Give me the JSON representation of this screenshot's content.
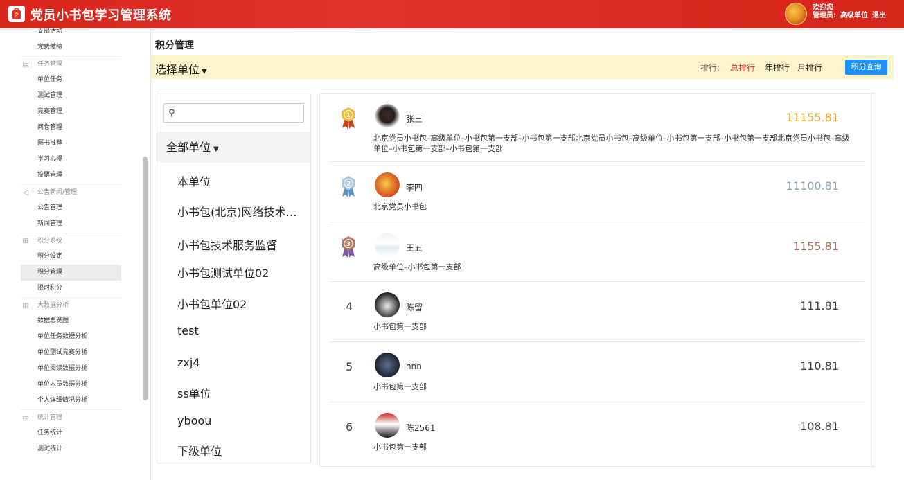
{
  "header": {
    "title": "党员小书包学习管理系统",
    "welcome": "欢迎您",
    "role_label": "管理员:",
    "unit_name": "高级单位",
    "logout": "退出"
  },
  "sidebar": {
    "items": [
      {
        "type": "item",
        "label": "支部活动"
      },
      {
        "type": "item",
        "label": "党费缴纳"
      },
      {
        "type": "group",
        "label": "任务管理",
        "icon": "list-icon"
      },
      {
        "type": "item",
        "label": "单位任务"
      },
      {
        "type": "item",
        "label": "测试管理"
      },
      {
        "type": "item",
        "label": "竞赛管理"
      },
      {
        "type": "item",
        "label": "问卷管理"
      },
      {
        "type": "item",
        "label": "图书推荐"
      },
      {
        "type": "item",
        "label": "学习心得"
      },
      {
        "type": "item",
        "label": "投票管理"
      },
      {
        "type": "group",
        "label": "公告新闻/管理",
        "icon": "speaker-icon"
      },
      {
        "type": "item",
        "label": "公告管理"
      },
      {
        "type": "item",
        "label": "新闻管理"
      },
      {
        "type": "group",
        "label": "积分系统",
        "icon": "gift-icon"
      },
      {
        "type": "item",
        "label": "积分设定"
      },
      {
        "type": "item",
        "label": "积分管理",
        "active": true
      },
      {
        "type": "item",
        "label": "限时积分"
      },
      {
        "type": "group",
        "label": "大数据分析",
        "icon": "bar-chart-icon"
      },
      {
        "type": "item",
        "label": "数据总览图"
      },
      {
        "type": "item",
        "label": "单位任务数据分析"
      },
      {
        "type": "item",
        "label": "单位测试竞赛分析"
      },
      {
        "type": "item",
        "label": "单位阅读数据分析"
      },
      {
        "type": "item",
        "label": "单位人员数据分析"
      },
      {
        "type": "item",
        "label": "个人详细情况分析"
      },
      {
        "type": "group",
        "label": "统计管理",
        "icon": "monitor-icon"
      },
      {
        "type": "item",
        "label": "任务统计"
      },
      {
        "type": "item",
        "label": "测试统计"
      }
    ]
  },
  "page": {
    "title": "积分管理",
    "unit_select": "选择单位",
    "rank_label": "排行:",
    "rank_options": [
      "总排行",
      "年排行",
      "月排行"
    ],
    "query_button": "积分查询"
  },
  "unit_panel": {
    "search_placeholder": "",
    "all_units": "全部单位",
    "units": [
      "本单位",
      "小书包(北京)网络技术有限公司",
      "小书包技术服务监督",
      "小书包测试单位02",
      "小书包单位02",
      "test",
      "zxj4",
      "ss单位",
      "yboou",
      "下级单位"
    ]
  },
  "ranking": [
    {
      "rank": "1",
      "name": "张三",
      "score": "11155.81",
      "score_color": "#e8a92a",
      "medal": "gold",
      "path": "北京党员小书包–高级单位–小书包第一支部–小书包第一支部北京党员小书包–高级单位–小书包第一支部–小书包第一支部北京党员小书包–高级单位–小书包第一支部–小书包第一支部"
    },
    {
      "rank": "2",
      "name": "李四",
      "score": "11100.81",
      "score_color": "#8ba5bd",
      "medal": "silver",
      "path": "北京党员小书包"
    },
    {
      "rank": "3",
      "name": "王五",
      "score": "1155.81",
      "score_color": "#a56a55",
      "medal": "bronze",
      "path": "高级单位–小书包第一支部"
    },
    {
      "rank": "4",
      "name": "陈留",
      "score": "111.81",
      "score_color": "#444444",
      "path": "小书包第一支部"
    },
    {
      "rank": "5",
      "name": "nnn",
      "score": "110.81",
      "score_color": "#444444",
      "path": "小书包第一支部"
    },
    {
      "rank": "6",
      "name": "陈2561",
      "score": "108.81",
      "score_color": "#444444",
      "path": "小书包第一支部"
    }
  ],
  "colors": {
    "header_red": "#d9251c",
    "active_rank": "#e0312a",
    "query_button": "#1e90ff",
    "filter_bar": "#fdf3cd"
  }
}
